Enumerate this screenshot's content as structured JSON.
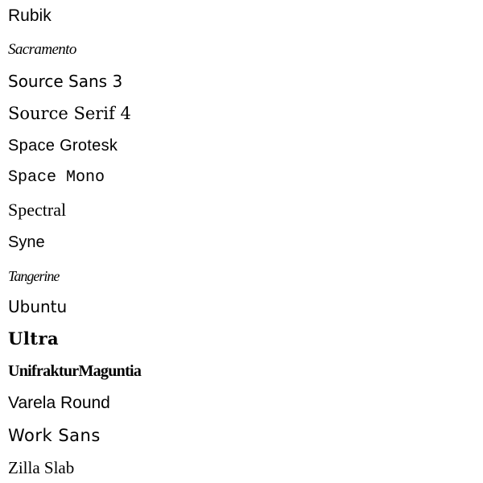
{
  "font_list": {
    "items": [
      {
        "label": "Rubik"
      },
      {
        "label": "Sacramento"
      },
      {
        "label": "Source Sans 3"
      },
      {
        "label": "Source Serif 4"
      },
      {
        "label": "Space Grotesk"
      },
      {
        "label": "Space Mono"
      },
      {
        "label": "Spectral"
      },
      {
        "label": "Syne"
      },
      {
        "label": "Tangerine"
      },
      {
        "label": "Ubuntu"
      },
      {
        "label": "Ultra"
      },
      {
        "label": "UnifrakturMaguntia"
      },
      {
        "label": "Varela Round"
      },
      {
        "label": "Work Sans"
      },
      {
        "label": "Zilla Slab"
      }
    ]
  }
}
